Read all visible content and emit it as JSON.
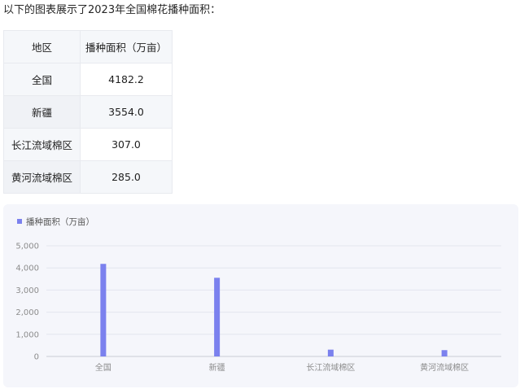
{
  "intro_text": "以下的图表展示了2023年全国棉花播种面积：",
  "table": {
    "headers": [
      "地区",
      "播种面积（万亩）"
    ],
    "rows": [
      {
        "region": "全国",
        "area": "4182.2"
      },
      {
        "region": "新疆",
        "area": "3554.0"
      },
      {
        "region": "长江流域棉区",
        "area": "307.0"
      },
      {
        "region": "黄河流域棉区",
        "area": "285.0"
      }
    ]
  },
  "colors": {
    "bar": "#7b81ee",
    "grid": "#e3e5ee",
    "card_bg": "#f5f6fb"
  },
  "chart_data": {
    "type": "bar",
    "categories": [
      "全国",
      "新疆",
      "长江流域棉区",
      "黄河流域棉区"
    ],
    "series": [
      {
        "name": "播种面积（万亩）",
        "values": [
          4182.2,
          3554.0,
          307.0,
          285.0
        ]
      }
    ],
    "ylim": [
      0,
      5000
    ],
    "yticks": [
      "0",
      "1,000",
      "2,000",
      "3,000",
      "4,000",
      "5,000"
    ],
    "ytick_values": [
      0,
      1000,
      2000,
      3000,
      4000,
      5000
    ],
    "legend_position": "top-left",
    "grid": true
  }
}
